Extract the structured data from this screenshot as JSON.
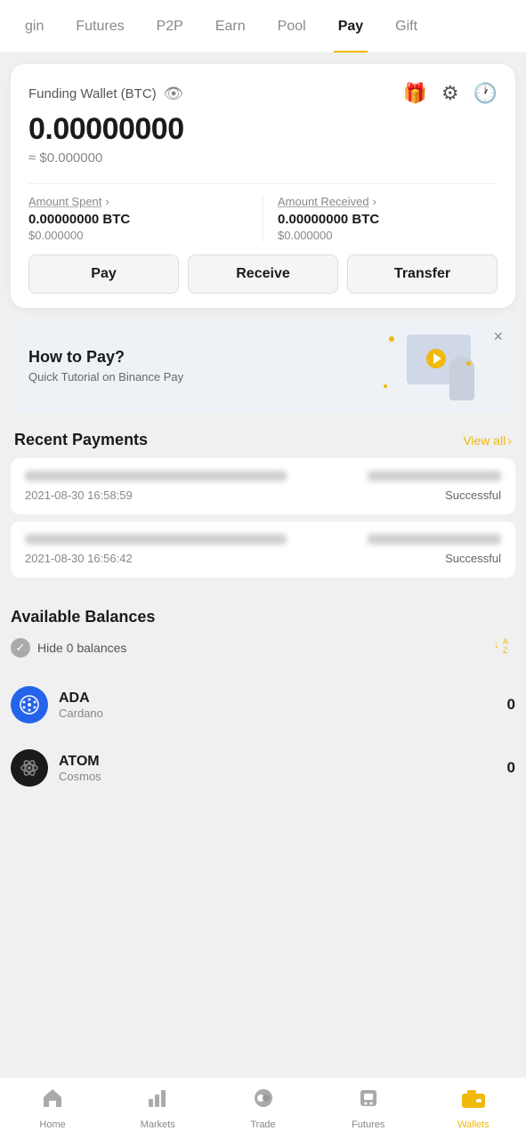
{
  "nav": {
    "tabs": [
      {
        "id": "margin",
        "label": "gin",
        "active": false
      },
      {
        "id": "futures",
        "label": "Futures",
        "active": false
      },
      {
        "id": "p2p",
        "label": "P2P",
        "active": false
      },
      {
        "id": "earn",
        "label": "Earn",
        "active": false
      },
      {
        "id": "pool",
        "label": "Pool",
        "active": false
      },
      {
        "id": "pay",
        "label": "Pay",
        "active": true
      },
      {
        "id": "gift",
        "label": "Gift",
        "active": false
      }
    ]
  },
  "wallet": {
    "title": "Funding Wallet (BTC)",
    "balance_btc": "0.00000000",
    "balance_approx": "≈ $0.000000",
    "amount_spent_label": "Amount Spent",
    "amount_spent_btc": "0.00000000 BTC",
    "amount_spent_usd": "$0.000000",
    "amount_received_label": "Amount Received",
    "amount_received_btc": "0.00000000 BTC",
    "amount_received_usd": "$0.000000",
    "buttons": {
      "pay": "Pay",
      "receive": "Receive",
      "transfer": "Transfer"
    }
  },
  "tutorial": {
    "title": "How to Pay?",
    "subtitle": "Quick Tutorial on Binance Pay"
  },
  "recent_payments": {
    "section_title": "Recent Payments",
    "view_all": "View all",
    "items": [
      {
        "date": "2021-08-30 16:58:59",
        "status": "Successful"
      },
      {
        "date": "2021-08-30 16:56:42",
        "status": "Successful"
      }
    ]
  },
  "available_balances": {
    "section_title": "Available Balances",
    "hide_label": "Hide 0 balances",
    "coins": [
      {
        "symbol": "ADA",
        "name": "Cardano",
        "balance": "0",
        "icon_type": "ada"
      },
      {
        "symbol": "ATOM",
        "name": "Cosmos",
        "balance": "0",
        "icon_type": "atom"
      }
    ]
  },
  "bottom_nav": {
    "items": [
      {
        "id": "home",
        "label": "Home",
        "icon": "🏠",
        "active": false
      },
      {
        "id": "markets",
        "label": "Markets",
        "icon": "📊",
        "active": false
      },
      {
        "id": "trade",
        "label": "Trade",
        "icon": "💱",
        "active": false
      },
      {
        "id": "futures",
        "label": "Futures",
        "icon": "📷",
        "active": false
      },
      {
        "id": "wallets",
        "label": "Wallets",
        "icon": "wallet",
        "active": true
      }
    ]
  },
  "icons": {
    "eye": "👁",
    "gift": "🎁",
    "gear": "⚙",
    "clock": "🕐",
    "check": "✓",
    "close": "×",
    "arrow_right": "›",
    "sort": "↓A/Z"
  }
}
